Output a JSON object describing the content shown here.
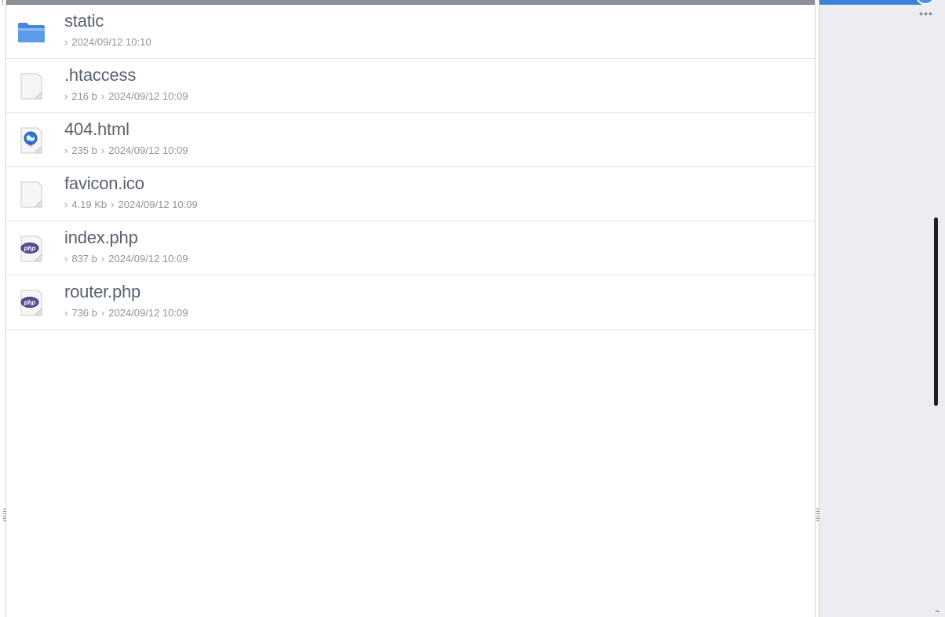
{
  "files": [
    {
      "name": "static",
      "icon": "folder-icon",
      "size": "",
      "modified": "2024/09/12 10:10"
    },
    {
      "name": ".htaccess",
      "icon": "blank-file-icon",
      "size": "216 b",
      "modified": "2024/09/12 10:09"
    },
    {
      "name": "404.html",
      "icon": "html-file-icon",
      "size": "235 b",
      "modified": "2024/09/12 10:09"
    },
    {
      "name": "favicon.ico",
      "icon": "blank-file-icon",
      "size": "4.19 Kb",
      "modified": "2024/09/12 10:09"
    },
    {
      "name": "index.php",
      "icon": "php-file-icon",
      "size": "837 b",
      "modified": "2024/09/12 10:09"
    },
    {
      "name": "router.php",
      "icon": "php-file-icon",
      "size": "736 b",
      "modified": "2024/09/12 10:09"
    }
  ],
  "separator": "›",
  "right_panel": {
    "more_label": "•••"
  },
  "colors": {
    "accent": "#3b82d9",
    "file_name": "#5a6270",
    "meta": "#8e949c",
    "php_badge": "#5b4e9a",
    "folder": "#5b9be8"
  }
}
